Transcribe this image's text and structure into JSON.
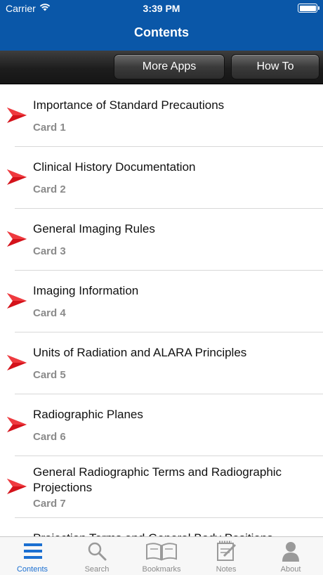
{
  "status_bar": {
    "carrier": "Carrier",
    "time": "3:39 PM"
  },
  "nav": {
    "title": "Contents"
  },
  "toolbar": {
    "more_apps": "More Apps",
    "how_to": "How To"
  },
  "list": {
    "items": [
      {
        "title": "Importance of Standard Precautions",
        "card": "Card 1"
      },
      {
        "title": "Clinical History Documentation",
        "card": "Card 2"
      },
      {
        "title": "General Imaging Rules",
        "card": "Card 3"
      },
      {
        "title": "Imaging Information",
        "card": "Card 4"
      },
      {
        "title": "Units of Radiation and ALARA Principles",
        "card": "Card 5"
      },
      {
        "title": "Radiographic Planes",
        "card": "Card 6"
      },
      {
        "title": "General Radiographic Terms and Radiographic Projections",
        "card": "Card 7"
      },
      {
        "title": "Projection Terms and General Body Positions",
        "card": ""
      }
    ]
  },
  "tabbar": {
    "tabs": [
      {
        "label": "Contents",
        "icon": "list-icon",
        "active": true
      },
      {
        "label": "Search",
        "icon": "search-icon",
        "active": false
      },
      {
        "label": "Bookmarks",
        "icon": "book-icon",
        "active": false
      },
      {
        "label": "Notes",
        "icon": "notepad-icon",
        "active": false
      },
      {
        "label": "About",
        "icon": "person-icon",
        "active": false
      }
    ]
  },
  "colors": {
    "nav_blue": "#0a57a8",
    "accent_red": "#d4131b",
    "active_tab": "#1b6fd1",
    "inactive_tab": "#8a8a8a"
  }
}
